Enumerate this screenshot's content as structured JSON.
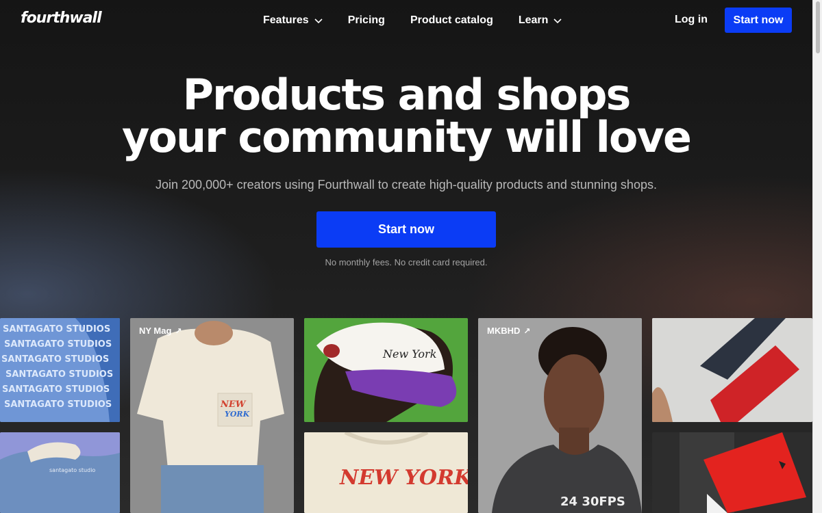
{
  "brand": {
    "logo": "fourthwall"
  },
  "nav": {
    "items": [
      {
        "label": "Features",
        "has_dropdown": true
      },
      {
        "label": "Pricing",
        "has_dropdown": false
      },
      {
        "label": "Product catalog",
        "has_dropdown": false
      },
      {
        "label": "Learn",
        "has_dropdown": true
      }
    ],
    "login": "Log in",
    "cta": "Start now"
  },
  "hero": {
    "title_line1": "Products and shops",
    "title_line2": "your community will love",
    "subtitle": "Join 200,000+ creators using Fourthwall to create high-quality products and stunning shops.",
    "cta": "Start now",
    "note": "No monthly fees. No credit card required."
  },
  "gallery": {
    "tiles": [
      {
        "name": "santagato-studios-hoodie",
        "label": ""
      },
      {
        "name": "santagato-denim-jacket",
        "label": "",
        "print_text": "santagato studio"
      },
      {
        "name": "ny-mag-tshirt",
        "label": "NY Mag"
      },
      {
        "name": "new-york-cap",
        "label": ""
      },
      {
        "name": "new-york-sweatshirt",
        "label": ""
      },
      {
        "name": "mkbhd-tshirt",
        "label": "MKBHD",
        "print_text": "24 30FPS"
      },
      {
        "name": "red-stripe-tshirt",
        "label": ""
      },
      {
        "name": "red-notebook",
        "label": ""
      }
    ],
    "hoodie_print": "SANTAGATO STUDIOS",
    "cap_print": "New York",
    "sweatshirt_print": "NEW YORK"
  },
  "colors": {
    "accent": "#0b3cf5",
    "background": "#1c1c1c"
  }
}
